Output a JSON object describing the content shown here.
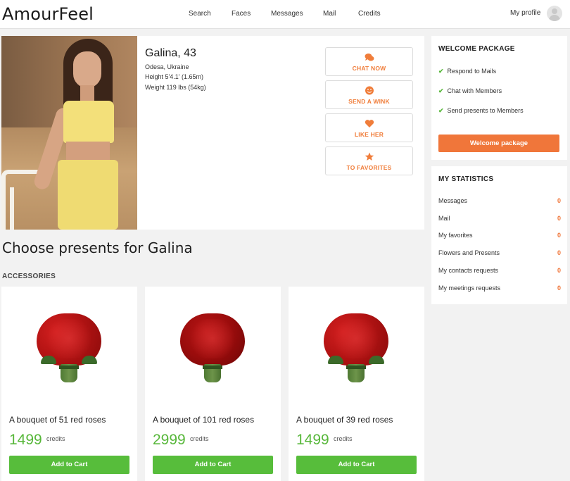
{
  "header": {
    "logo": "AmourFeel",
    "nav": [
      "Search",
      "Faces",
      "Messages",
      "Mail",
      "Credits"
    ],
    "profile_label": "My profile"
  },
  "profile": {
    "name": "Galina, 43",
    "location": "Odesa, Ukraine",
    "height": "Height 5'4.1' (1.65m)",
    "weight": "Weight 119 lbs (54kg)",
    "actions": [
      {
        "label": "CHAT NOW",
        "icon": "chat-icon"
      },
      {
        "label": "SEND A WINK",
        "icon": "smile-icon"
      },
      {
        "label": "LIKE HER",
        "icon": "heart-icon"
      },
      {
        "label": "TO FAVORITES",
        "icon": "star-icon"
      }
    ]
  },
  "presents": {
    "title": "Choose presents for Galina",
    "category": "ACCESSORIES",
    "credits_unit": "credits",
    "add_label": "Add to Cart",
    "products": [
      {
        "name": "A bouquet of 51 red roses",
        "price": "1499"
      },
      {
        "name": "A bouquet of 101 red roses",
        "price": "2999"
      },
      {
        "name": "A bouquet of 39 red roses",
        "price": "1499"
      }
    ]
  },
  "welcome": {
    "title": "WELCOME PACKAGE",
    "items": [
      "Respond to Mails",
      "Chat with Members",
      "Send presents to Members"
    ],
    "button": "Welcome package"
  },
  "stats": {
    "title": "MY STATISTICS",
    "rows": [
      {
        "label": "Messages",
        "value": "0"
      },
      {
        "label": "Mail",
        "value": "0"
      },
      {
        "label": "My favorites",
        "value": "0"
      },
      {
        "label": "Flowers and Presents",
        "value": "0"
      },
      {
        "label": "My contacts requests",
        "value": "0"
      },
      {
        "label": "My meetings requests",
        "value": "0"
      }
    ]
  },
  "colors": {
    "accent_orange": "#f0763a",
    "accent_green": "#57bd3b",
    "price_green": "#57b73a",
    "background": "#f2f2f2"
  }
}
